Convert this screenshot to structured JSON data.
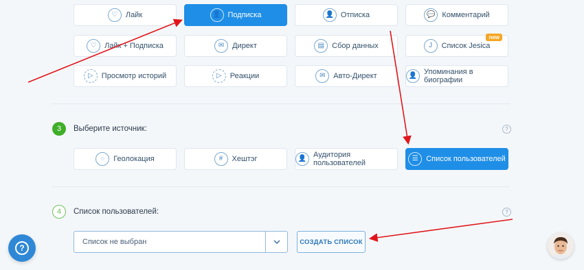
{
  "actions": [
    {
      "label": "Лайк",
      "icon": "heart-icon",
      "glyph": "♡",
      "active": false
    },
    {
      "label": "Подписка",
      "icon": "user-plus-icon",
      "glyph": "👤",
      "active": true
    },
    {
      "label": "Отписка",
      "icon": "user-minus-icon",
      "glyph": "👤",
      "active": false
    },
    {
      "label": "Комментарий",
      "icon": "comment-icon",
      "glyph": "💬",
      "active": false
    },
    {
      "label": "Лайк + Подписка",
      "icon": "heart-user-icon",
      "glyph": "♡",
      "active": false
    },
    {
      "label": "Директ",
      "icon": "mail-icon",
      "glyph": "✉",
      "active": false
    },
    {
      "label": "Сбор данных",
      "icon": "data-collect-icon",
      "glyph": "▤",
      "active": false
    },
    {
      "label": "Список Jesica",
      "icon": "jesica-icon",
      "glyph": "J",
      "active": false,
      "badge": "new"
    },
    {
      "label": "Просмотр историй",
      "icon": "play-icon",
      "glyph": "▷",
      "active": false
    },
    {
      "label": "Реакции",
      "icon": "reactions-icon",
      "glyph": "▷",
      "active": false
    },
    {
      "label": "Авто-Директ",
      "icon": "auto-mail-icon",
      "glyph": "✉",
      "active": false
    },
    {
      "label": "Упоминания в биографии",
      "icon": "bio-mention-icon",
      "glyph": "👤",
      "active": false
    }
  ],
  "step3": {
    "number": "3",
    "title": "Выберите источник:",
    "sources": [
      {
        "label": "Геолокация",
        "icon": "location-icon",
        "glyph": "◌",
        "active": false
      },
      {
        "label": "Хештэг",
        "icon": "hashtag-icon",
        "glyph": "#",
        "active": false
      },
      {
        "label": "Аудитория пользователей",
        "icon": "audience-icon",
        "glyph": "👤",
        "active": false
      },
      {
        "label": "Список пользователей",
        "icon": "list-icon",
        "glyph": "☰",
        "active": true
      }
    ]
  },
  "step4": {
    "number": "4",
    "title": "Список пользователей:",
    "select_value": "Список не выбран",
    "create_label": "СОЗДАТЬ СПИСОК"
  },
  "help_glyph": "?",
  "colors": {
    "accent": "#1f8ee6",
    "step_done": "#3fae29",
    "arrow": "#e0161b",
    "badge": "#f5a623"
  }
}
